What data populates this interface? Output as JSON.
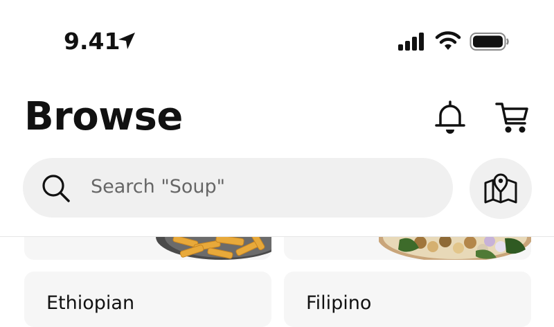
{
  "status_bar": {
    "time": "9.41",
    "icons": [
      "location-arrow-icon",
      "cellular-signal-icon",
      "wifi-icon",
      "battery-icon"
    ]
  },
  "header": {
    "title": "Browse",
    "icons": [
      "bell-icon",
      "cart-icon"
    ]
  },
  "search": {
    "placeholder": "Search \"Soup\"",
    "icon": "search-icon",
    "map_icon": "map-pin-icon"
  },
  "categories": [
    {
      "label": "",
      "image": "fries-image"
    },
    {
      "label": "",
      "image": "salad-image"
    },
    {
      "label": "Ethiopian"
    },
    {
      "label": "Filipino"
    }
  ],
  "colors": {
    "background": "#ffffff",
    "search_bg": "#f0f0f0",
    "card_bg": "#f6f6f6",
    "text": "#111111",
    "placeholder": "#666666"
  }
}
